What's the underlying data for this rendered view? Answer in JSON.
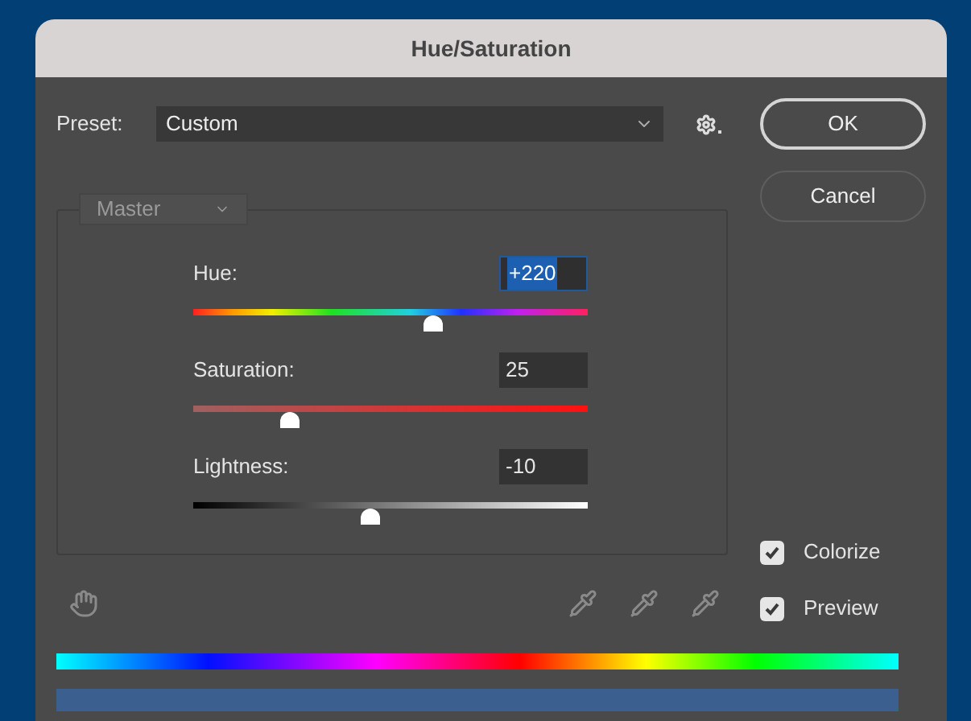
{
  "window": {
    "title": "Hue/Saturation"
  },
  "preset": {
    "label": "Preset:",
    "value": "Custom"
  },
  "channel": {
    "value": "Master",
    "disabled": true
  },
  "sliders": [
    {
      "kind": "hue",
      "label": "Hue:",
      "value": "+220",
      "selected": true,
      "level": 0.61
    },
    {
      "kind": "saturation",
      "label": "Saturation:",
      "value": "25",
      "selected": false,
      "level": 0.245
    },
    {
      "kind": "lightness",
      "label": "Lightness:",
      "value": "-10",
      "selected": false,
      "level": 0.45
    }
  ],
  "buttons": [
    {
      "label": "OK",
      "default": true
    },
    {
      "label": "Cancel",
      "default": false
    }
  ],
  "checkboxes": [
    {
      "label": "Colorize",
      "checked": true
    },
    {
      "label": "Preview",
      "checked": true
    }
  ]
}
